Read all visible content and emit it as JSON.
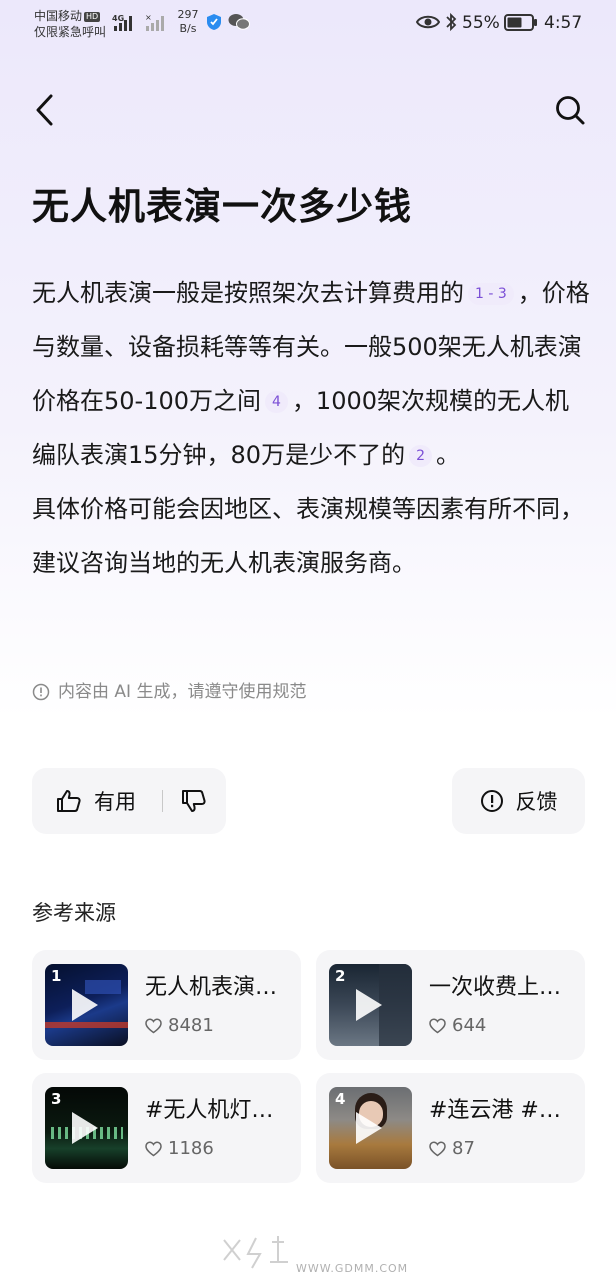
{
  "status_bar": {
    "carrier": "中国移动",
    "hd_badge": "HD",
    "emergency": "仅限紧急呼叫",
    "network": "4G",
    "speed_value": "297",
    "speed_unit": "B/s",
    "battery_percent": "55%",
    "time": "4:57"
  },
  "header": {
    "back_icon": "chevron-left-icon",
    "search_icon": "search-icon"
  },
  "title": "无人机表演一次多少钱",
  "answer": {
    "p1_a": "无人机表演一般是按照架次去计算费用的",
    "cite_1": "1 - 3",
    "p1_b": "，价格与数量、设备损耗等等有关。一般500架无人机表演价格在50-100万之间",
    "cite_2": "4",
    "p1_c": "，1000架次规模的无人机编队表演15分钟，80万是少不了的",
    "cite_3": "2",
    "p1_d": "。",
    "p2": "具体价格可能会因地区、表演规模等因素有所不同，建议咨询当地的无人机表演服务商。"
  },
  "ai_note": "内容由 AI 生成，请遵守使用规范",
  "feedback": {
    "useful_label": "有用",
    "feedback_label": "反馈"
  },
  "references": {
    "title": "参考来源",
    "items": [
      {
        "num": "1",
        "text": "无人机表演…",
        "likes": "8481"
      },
      {
        "num": "2",
        "text": "一次收费上…",
        "likes": "644"
      },
      {
        "num": "3",
        "text": "#无人机灯…",
        "likes": "1186"
      },
      {
        "num": "4",
        "text": "#连云港 #…",
        "likes": "87"
      }
    ]
  },
  "watermark": "WWW.GDMM.COM",
  "colors": {
    "accent": "#7b4fd6",
    "cite_bg": "#f0ebfb",
    "card_bg": "#f5f5f7"
  }
}
